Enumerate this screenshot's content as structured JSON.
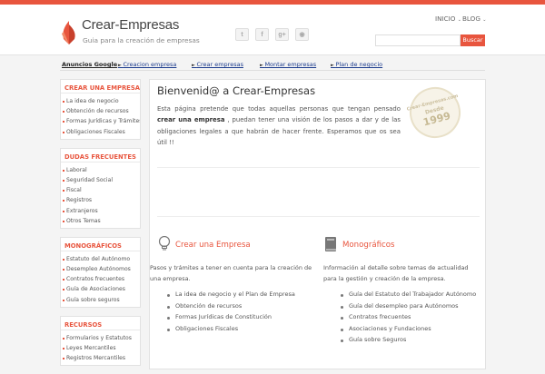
{
  "header": {
    "site_title": "Crear-Empresas",
    "tagline": "Guia para la creación de empresas",
    "nav": [
      "INICIO",
      "BLOG"
    ],
    "social": [
      {
        "icon": "twitter-icon",
        "glyph": "t"
      },
      {
        "icon": "facebook-icon",
        "glyph": "f"
      },
      {
        "icon": "google-plus-icon",
        "glyph": "g+"
      },
      {
        "icon": "rss-icon",
        "glyph": "◉"
      }
    ],
    "search_placeholder": "",
    "search_button": "Buscar",
    "accent_color": "#e8553e"
  },
  "adbar": {
    "label": "Anuncios Google",
    "links": [
      "Creacion empresa",
      "Crear empresas",
      "Montar empresas",
      "Plan de negocio"
    ]
  },
  "sidebar": [
    {
      "title": "CREAR UNA EMPRESA",
      "items": [
        "La idea de negocio",
        "Obtención de recursos",
        "Formas Jurídicas y Trámites",
        "Obligaciones Fiscales"
      ]
    },
    {
      "title": "DUDAS FRECUENTES",
      "items": [
        "Laboral",
        "Seguridad Social",
        "Fiscal",
        "Registros",
        "Extranjeros",
        "Otros Temas"
      ]
    },
    {
      "title": "MONOGRÁFICOS",
      "items": [
        "Estatuto del Autónomo",
        "Desempleo Autónomos",
        "Contratos frecuentes",
        "Guía de Asociaciones",
        "Guía sobre seguros"
      ]
    },
    {
      "title": "RECURSOS",
      "items": [
        "Formularios y Estatutos",
        "Leyes Mercantiles",
        "Registros Mercantiles"
      ]
    }
  ],
  "main": {
    "welcome_title": "Bienvenid@ a Crear-Empresas",
    "welcome_before": "Esta página pretende que todas aquellas personas que tengan pensado ",
    "welcome_bold": "crear una empresa",
    "welcome_after": " , puedan tener una visión de los pasos a dar y de las obligaciones legales a que habrán de hacer frente. Esperamos que os sea útil !!",
    "stamp": {
      "line1": "Crear-Empresas.com",
      "line2": "Desde",
      "line3": "1999"
    },
    "columns": [
      {
        "icon": "lightbulb-icon",
        "title": "Crear una Empresa",
        "desc": "Pasos y trámites a tener en cuenta para la creación de una empresa.",
        "items": [
          "La idea de negocio y el Plan de Empresa",
          "Obtención de recursos",
          "Formas Jurídicas de Constitución",
          "Obligaciones Fiscales"
        ]
      },
      {
        "icon": "book-icon",
        "title": "Monográficos",
        "desc": "Información al detalle sobre temas de actualidad para la gestión y creación de la empresa.",
        "items": [
          "Guía del Estatuto del Trabajador Autónomo",
          "Guía del desempleo para Autónomos",
          "Contratos frecuentes",
          "Asociaciones y Fundaciones",
          "Guía sobre Seguros"
        ]
      }
    ]
  }
}
